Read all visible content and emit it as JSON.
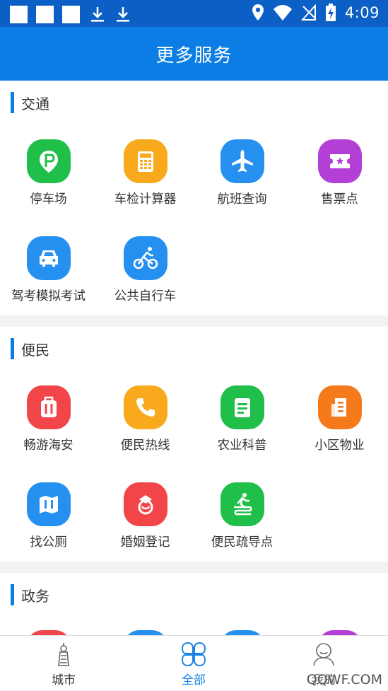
{
  "status_bar": {
    "time": "4:09"
  },
  "header": {
    "title": "更多服务"
  },
  "sections": [
    {
      "title": "交通",
      "items": [
        {
          "label": "停车场",
          "icon": "parking-icon",
          "color": "#1fbf4a"
        },
        {
          "label": "车检计算器",
          "icon": "calculator-icon",
          "color": "#f8a91c"
        },
        {
          "label": "航班查询",
          "icon": "airplane-icon",
          "color": "#2590f0"
        },
        {
          "label": "售票点",
          "icon": "ticket-icon",
          "color": "#b33fd6"
        },
        {
          "label": "驾考模拟考试",
          "icon": "car-icon",
          "color": "#2590f0"
        },
        {
          "label": "公共自行车",
          "icon": "bicycle-icon",
          "color": "#2590f0"
        }
      ]
    },
    {
      "title": "便民",
      "items": [
        {
          "label": "畅游海安",
          "icon": "luggage-icon",
          "color": "#f2454a"
        },
        {
          "label": "便民热线",
          "icon": "phone-icon",
          "color": "#f8a91c"
        },
        {
          "label": "农业科普",
          "icon": "document-icon",
          "color": "#1fbf4a"
        },
        {
          "label": "小区物业",
          "icon": "building-icon",
          "color": "#f57a1b"
        },
        {
          "label": "找公厕",
          "icon": "toilet-icon",
          "color": "#2590f0"
        },
        {
          "label": "婚姻登记",
          "icon": "marriage-icon",
          "color": "#f2454a"
        },
        {
          "label": "便民疏导点",
          "icon": "guide-icon",
          "color": "#1fbf4a"
        }
      ]
    },
    {
      "title": "政务",
      "items": [
        {
          "label": "",
          "icon": "gov-icon-1",
          "color": "#f2454a"
        },
        {
          "label": "",
          "icon": "gov-icon-2",
          "color": "#2590f0"
        },
        {
          "label": "",
          "icon": "gov-icon-3",
          "color": "#2590f0"
        },
        {
          "label": "",
          "icon": "gov-icon-4",
          "color": "#b33fd6"
        }
      ]
    }
  ],
  "bottom_nav": [
    {
      "label": "城市",
      "icon": "city-tower-icon",
      "active": false
    },
    {
      "label": "全部",
      "icon": "all-grid-icon",
      "active": true
    },
    {
      "label": "我的",
      "icon": "profile-icon",
      "active": false
    }
  ],
  "watermark": "QQWF.COM"
}
